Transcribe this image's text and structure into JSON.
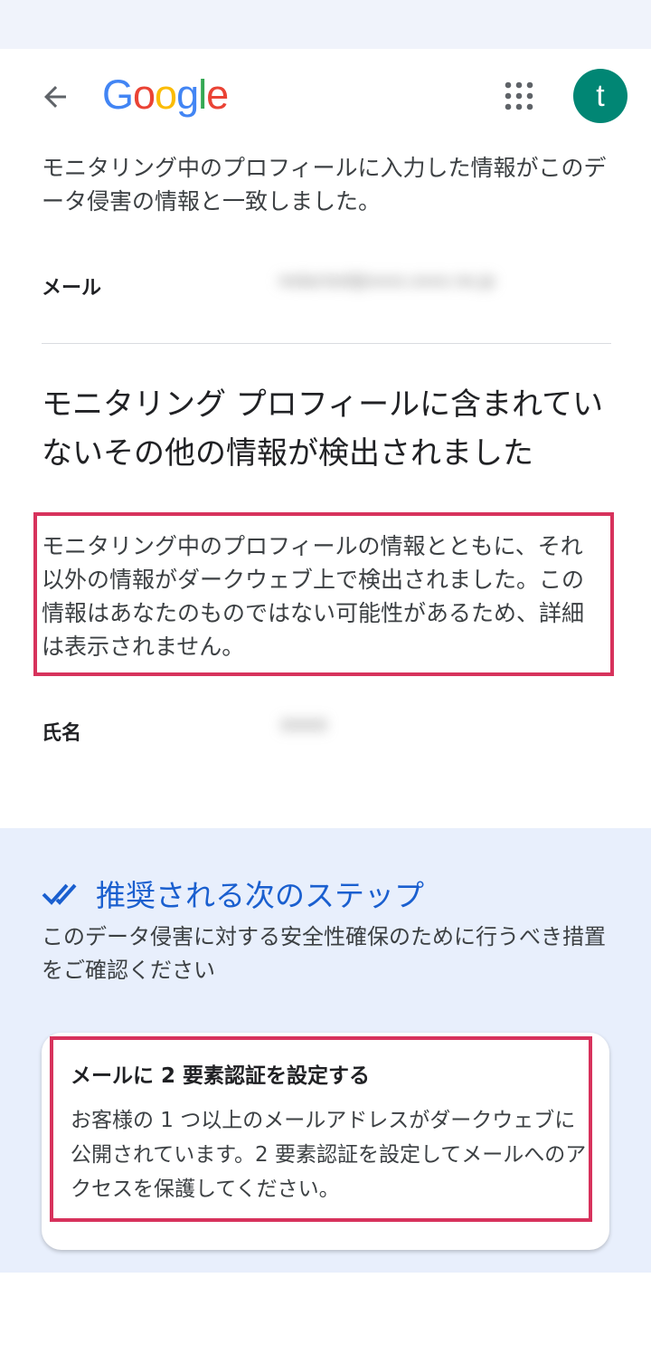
{
  "header": {
    "back_icon": "arrow-back-icon",
    "logo_letters": [
      {
        "char": "G",
        "color": "#4285F4"
      },
      {
        "char": "o",
        "color": "#EA4335"
      },
      {
        "char": "o",
        "color": "#FBBC05"
      },
      {
        "char": "g",
        "color": "#4285F4"
      },
      {
        "char": "l",
        "color": "#34A853"
      },
      {
        "char": "e",
        "color": "#EA4335"
      }
    ],
    "apps_icon": "apps-grid-icon",
    "avatar_initial": "t",
    "avatar_color": "#018674"
  },
  "breach_match": {
    "description": "モニタリング中のプロフィールに入力した情報がこのデータ侵害の情報と一致しました。",
    "email_label": "メール",
    "email_value": "redacted@xxxx.xxxx.ne.jp"
  },
  "other_info": {
    "heading": "モニタリング プロフィールに含まれていないその他の情報が検出されました",
    "description": "モニタリング中のプロフィールの情報とともに、それ以外の情報がダークウェブ上で検出されました。この情報はあなたのものではない可能性があるため、詳細は表示されません。",
    "name_label": "氏名",
    "name_value": "xxxx"
  },
  "recommendations": {
    "icon": "double-check-icon",
    "title": "推奨される次のステップ",
    "description": "このデータ侵害に対する安全性確保のために行うべき措置をご確認ください",
    "accent_color": "#1a5fcf",
    "card": {
      "title": "メールに 2 要素認証を設定する",
      "description": "お客様の 1 つ以上のメールアドレスがダークウェブに公開されています。2 要素認証を設定してメールへのアクセスを保護してください。"
    }
  },
  "highlight_color": "#d7325c"
}
